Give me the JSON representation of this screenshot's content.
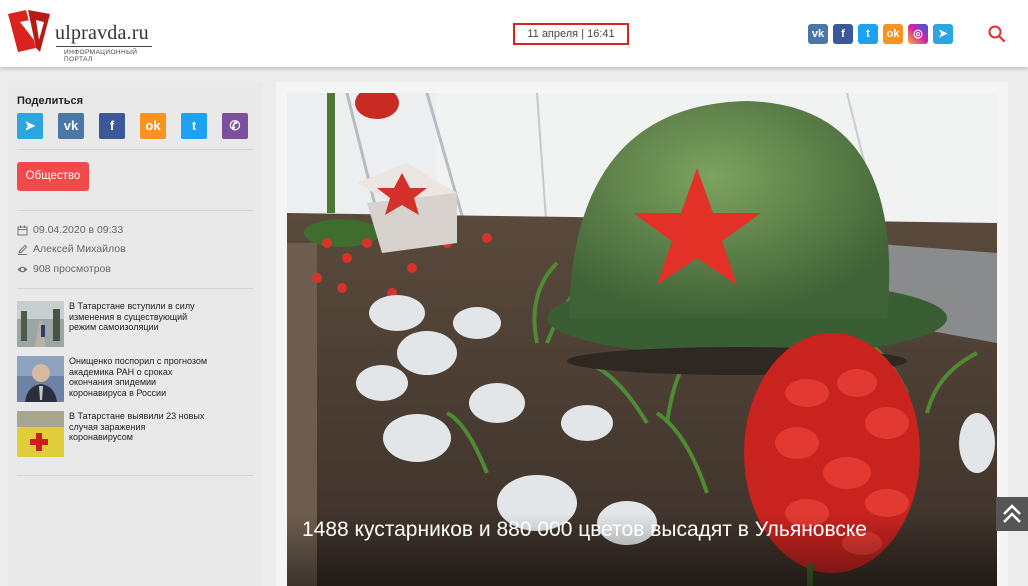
{
  "header": {
    "logo_name": "ulpravda.ru",
    "logo_sub": "ИНФОРМАЦИОННЫЙ ПОРТАЛ",
    "datetime": "11 апреля | 16:41",
    "social": [
      {
        "icon": "vk-icon",
        "glyph": "vk",
        "color": "#4a76a8"
      },
      {
        "icon": "facebook-icon",
        "glyph": "f",
        "color": "#3b5998"
      },
      {
        "icon": "twitter-icon",
        "glyph": "t",
        "color": "#1da1f2"
      },
      {
        "icon": "odnoklassniki-icon",
        "glyph": "ok",
        "color": "#f7931e"
      },
      {
        "icon": "instagram-icon",
        "glyph": "◎",
        "color": "#d6249f"
      },
      {
        "icon": "telegram-icon",
        "glyph": "➤",
        "color": "#2ca5e0"
      }
    ],
    "search_icon": "search-icon"
  },
  "sidebar": {
    "share_title": "Поделиться",
    "share": [
      {
        "icon": "telegram-icon",
        "glyph": "➤",
        "color": "#2ca5e0"
      },
      {
        "icon": "vk-icon",
        "glyph": "vk",
        "color": "#4a76a8"
      },
      {
        "icon": "facebook-icon",
        "glyph": "f",
        "color": "#3b5998"
      },
      {
        "icon": "odnoklassniki-icon",
        "glyph": "ok",
        "color": "#f7931e"
      },
      {
        "icon": "twitter-icon",
        "glyph": "t",
        "color": "#1da1f2"
      },
      {
        "icon": "viber-icon",
        "glyph": "✆",
        "color": "#7b519d"
      }
    ],
    "tag": "Общество",
    "date": "09.04.2020 в 09:33",
    "author": "Алексей Михайлов",
    "views": "908 просмотров",
    "news": [
      {
        "text": "В Татарстане вступили в силу изменения в существующий режим самоизоляции"
      },
      {
        "text": "Онищенко поспорил с прогнозом академика РАН о сроках окончания эпидемии коронавируса в России"
      },
      {
        "text": "В Татарстане выявили 23 новых случая заражения коронавирусом"
      }
    ]
  },
  "main": {
    "title": "1488 кустарников и 880 000 цветов высадят в Ульяновске"
  },
  "colors": {
    "accent": "#f24a4a",
    "brand_red": "#d9231f"
  }
}
